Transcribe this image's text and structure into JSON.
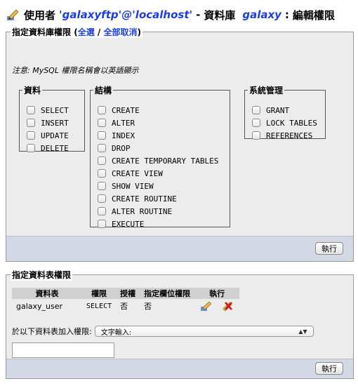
{
  "header": {
    "user_label": "使用者",
    "user_value": "'galaxyftp'@'localhost'",
    "dash": "-",
    "db_label": "資料庫",
    "db_value": "galaxy",
    "colon": ":",
    "page_title": "編輯權限"
  },
  "db_privs": {
    "legend": "指定資料庫權限",
    "paren_open": "(",
    "select_all": "全選",
    "slash": "/",
    "deselect_all": "全部取消",
    "paren_close": ")",
    "note": "注意: MySQL 權限名稱會以英語顯示",
    "groups": {
      "data": {
        "legend": "資料",
        "items": [
          "SELECT",
          "INSERT",
          "UPDATE",
          "DELETE"
        ]
      },
      "structure": {
        "legend": "結構",
        "items": [
          "CREATE",
          "ALTER",
          "INDEX",
          "DROP",
          "CREATE TEMPORARY TABLES",
          "CREATE VIEW",
          "SHOW VIEW",
          "CREATE ROUTINE",
          "ALTER ROUTINE",
          "EXECUTE"
        ]
      },
      "admin": {
        "legend": "系統管理",
        "items": [
          "GRANT",
          "LOCK TABLES",
          "REFERENCES"
        ]
      }
    },
    "go_button": "執行"
  },
  "table_privs": {
    "legend": "指定資料表權限",
    "columns": [
      "資料表",
      "權限",
      "授權",
      "指定欄位權限",
      "執行"
    ],
    "rows": [
      {
        "table": "galaxy_user",
        "privs": "SELECT",
        "grant": "否",
        "column_privs": "否",
        "actions": [
          "edit-privileges-icon",
          "revoke-icon"
        ]
      }
    ],
    "add_label": "於以下資料表加入權限:",
    "select_value": "文字輸入:",
    "text_input_value": "",
    "go_button": "執行"
  },
  "colors": {
    "accent": "#1f3fd8",
    "panel_bg": "#ececec",
    "footer_bg": "#d2d9e4"
  }
}
